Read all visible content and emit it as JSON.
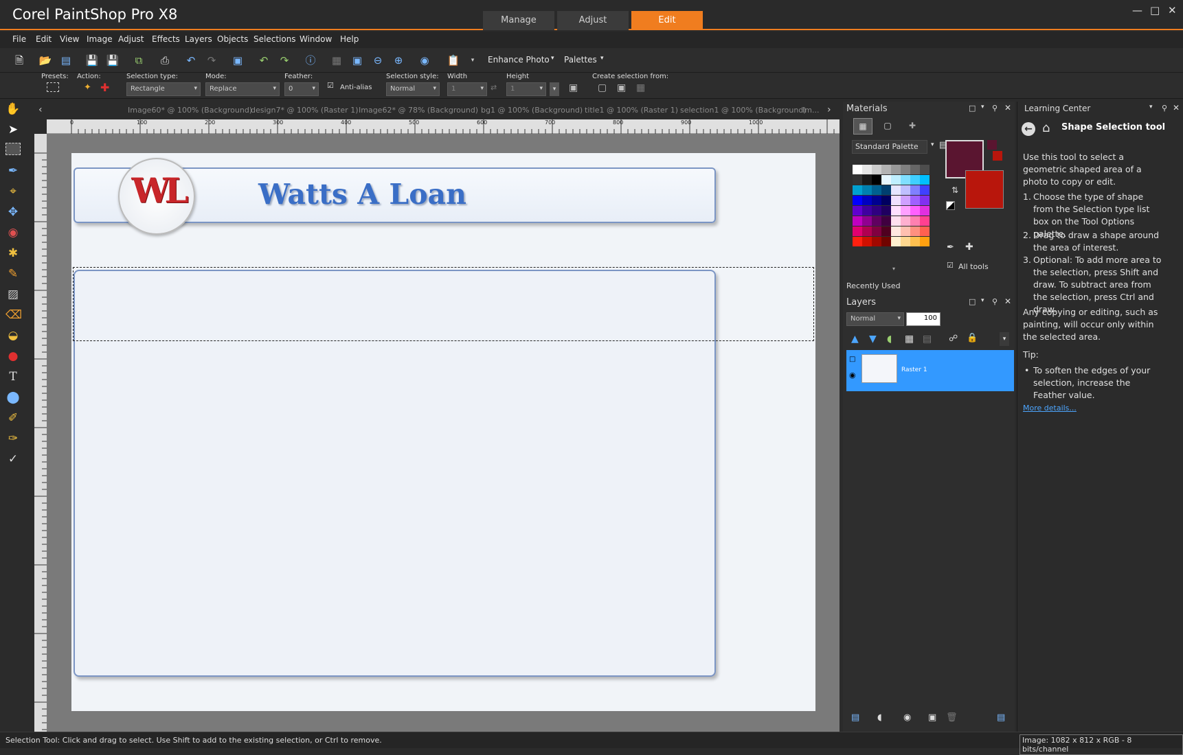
{
  "app": {
    "title": "Corel PaintShop Pro X8",
    "workspace_tabs": [
      {
        "label": "Manage"
      },
      {
        "label": "Adjust"
      },
      {
        "label": "Edit"
      }
    ]
  },
  "menu": {
    "items": [
      "File",
      "Edit",
      "View",
      "Image",
      "Adjust",
      "Effects",
      "Layers",
      "Objects",
      "Selections",
      "Window",
      "Help"
    ]
  },
  "toolbar": {
    "enhance_photo": "Enhance Photo",
    "palettes": "Palettes"
  },
  "tool_options": {
    "presets_label": "Presets:",
    "action_label": "Action:",
    "selection_type_label": "Selection type:",
    "selection_type_value": "Rectangle",
    "mode_label": "Mode:",
    "mode_value": "Replace",
    "feather_label": "Feather:",
    "feather_value": "0",
    "antialias_label": "Anti-alias",
    "selection_style_label": "Selection style:",
    "selection_style_value": "Normal",
    "width_label": "Width",
    "width_value": "1",
    "height_label": "Height",
    "height_value": "1",
    "create_from_label": "Create selection from:"
  },
  "documents": {
    "tabs": [
      "Image60* @ 100% (Background)",
      "design7* @ 100% (Raster 1)",
      "Image62* @  78% (Background)",
      "bg1 @ 100% (Background)",
      "title1 @ 100% (Raster 1)",
      "selection1 @ 100% (Background)",
      "Im..."
    ],
    "ruler_labels": [
      "0",
      "100",
      "200",
      "300",
      "400",
      "500",
      "600",
      "700",
      "800",
      "900",
      "1000"
    ]
  },
  "canvas": {
    "logo_text": "WL",
    "banner_title": "Watts A Loan"
  },
  "materials": {
    "title": "Materials",
    "palette_dropdown": "Standard Palette",
    "recently_used": "Recently Used",
    "all_tools": "All tools",
    "fg_color": "#5a1530",
    "bg_color": "#b8160c"
  },
  "layers": {
    "title": "Layers",
    "blend_mode": "Normal",
    "opacity": "100",
    "layer_name": "Raster 1"
  },
  "learning_center": {
    "title": "Learning Center",
    "heading": "Shape Selection tool",
    "intro": "Use this tool to select a geometric shaped area of a photo to copy or edit.",
    "steps": [
      "Choose the type of shape from the Selection type list box on the Tool Options palette.",
      "Drag to draw a shape around the area of interest.",
      "Optional: To add more area to the selection, press Shift and draw. To subtract area from the selection, press Ctrl and draw."
    ],
    "note": "Any copying or editing, such as painting, will occur only within the selected area.",
    "tip_label": "Tip:",
    "tip": "To soften the edges of your selection, increase the Feather value.",
    "more_details": "More details..."
  },
  "status": {
    "message": "Selection Tool: Click and drag to select. Use Shift to add to the existing selection, or Ctrl to remove.",
    "image_info": "Image: 1082 x 812 x RGB - 8 bits/channel"
  },
  "colors": {
    "accent": "#f07d1f",
    "layer_selected": "#3399ff"
  }
}
